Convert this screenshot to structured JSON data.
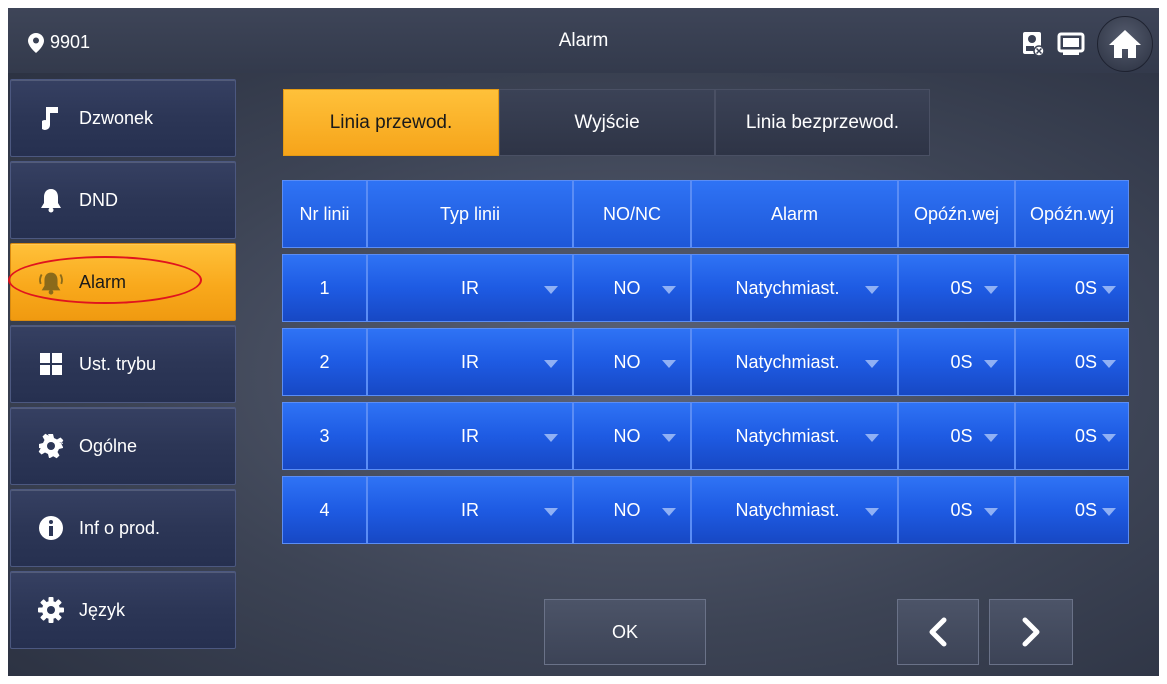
{
  "header": {
    "location": "9901",
    "title": "Alarm"
  },
  "sidebar": {
    "items": [
      {
        "label": "Dzwonek",
        "icon": "music-note-icon",
        "active": false
      },
      {
        "label": "DND",
        "icon": "bell-icon",
        "active": false
      },
      {
        "label": "Alarm",
        "icon": "alarm-bell-icon",
        "active": true
      },
      {
        "label": "Ust. trybu",
        "icon": "grid-icon",
        "active": false
      },
      {
        "label": "Ogólne",
        "icon": "gear-icon",
        "active": false
      },
      {
        "label": "Inf o prod.",
        "icon": "info-icon",
        "active": false
      },
      {
        "label": "Język",
        "icon": "gear-icon",
        "active": false
      }
    ]
  },
  "tabs": [
    {
      "label": "Linia przewod.",
      "active": true
    },
    {
      "label": "Wyjście",
      "active": false
    },
    {
      "label": "Linia bezprzewod.",
      "active": false
    }
  ],
  "table": {
    "headers": [
      "Nr linii",
      "Typ linii",
      "NO/NC",
      "Alarm",
      "Opóźn.wej",
      "Opóźn.wyj"
    ],
    "rows": [
      [
        "1",
        "IR",
        "NO",
        "Natychmiast.",
        "0S",
        "0S"
      ],
      [
        "2",
        "IR",
        "NO",
        "Natychmiast.",
        "0S",
        "0S"
      ],
      [
        "3",
        "IR",
        "NO",
        "Natychmiast.",
        "0S",
        "0S"
      ],
      [
        "4",
        "IR",
        "NO",
        "Natychmiast.",
        "0S",
        "0S"
      ]
    ]
  },
  "buttons": {
    "ok": "OK"
  },
  "colors": {
    "accent": "#f9a91c",
    "cell_blue": "#1e5be3",
    "annotation": "#e0141e"
  }
}
